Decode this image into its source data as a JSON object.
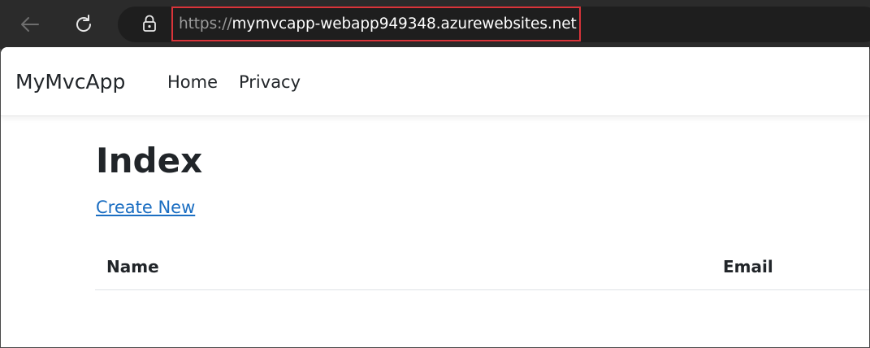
{
  "browser": {
    "url_scheme": "https://",
    "url_host": "mymvcapp-webapp949348.azurewebsites.net"
  },
  "site": {
    "brand": "MyMvcApp",
    "nav": [
      "Home",
      "Privacy"
    ]
  },
  "main": {
    "title": "Index",
    "create_link": "Create New",
    "table_headers": [
      "Name",
      "Email"
    ]
  },
  "colors": {
    "highlight_box": "#d9343a",
    "link": "#1b6ec2"
  }
}
